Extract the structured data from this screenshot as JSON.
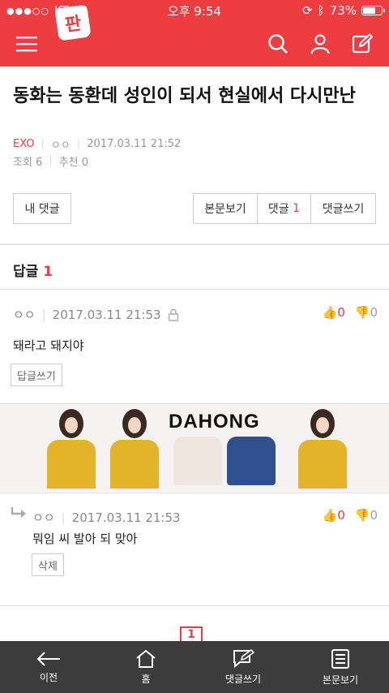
{
  "status": {
    "carrier": "KT",
    "time": "오후 9:54",
    "battery": "73%",
    "battery_level": 0.73
  },
  "header": {
    "logo_text": "판"
  },
  "post": {
    "title": "동화는 동환데 성인이 되서 현실에서 다시만난",
    "category": "EXO",
    "author": "ㅇㅇ",
    "date": "2017.03.11 21:52",
    "views": "조회 6",
    "recommend": "추천 0"
  },
  "actions": {
    "my_comments": "내 댓글",
    "view_body": "본문보기",
    "comments": "댓글",
    "comments_count": "1",
    "write_comment": "댓글쓰기"
  },
  "replies": {
    "heading": "답글",
    "count": "1",
    "items": [
      {
        "author": "ㅇㅇ",
        "date": "2017.03.11 21:53",
        "text": "돼라고 돼지야",
        "up": "0",
        "down": "0",
        "button": "답글쓰기"
      },
      {
        "author": "ㅇㅇ",
        "date": "2017.03.11 21:53",
        "text": "뭐임 씨 발아 되 맞아",
        "up": "0",
        "down": "0",
        "button": "삭제"
      }
    ]
  },
  "banner": {
    "brand": "DAHONG"
  },
  "pager": {
    "current": "1"
  },
  "bottom_nav": [
    {
      "label": "이전",
      "icon": "back-arrow-icon"
    },
    {
      "label": "홈",
      "icon": "home-icon"
    },
    {
      "label": "댓글쓰기",
      "icon": "comment-write-icon"
    },
    {
      "label": "본문보기",
      "icon": "document-icon"
    }
  ],
  "colors": {
    "accent": "#ee3d41",
    "bottom_bar": "#3c3c3c"
  }
}
